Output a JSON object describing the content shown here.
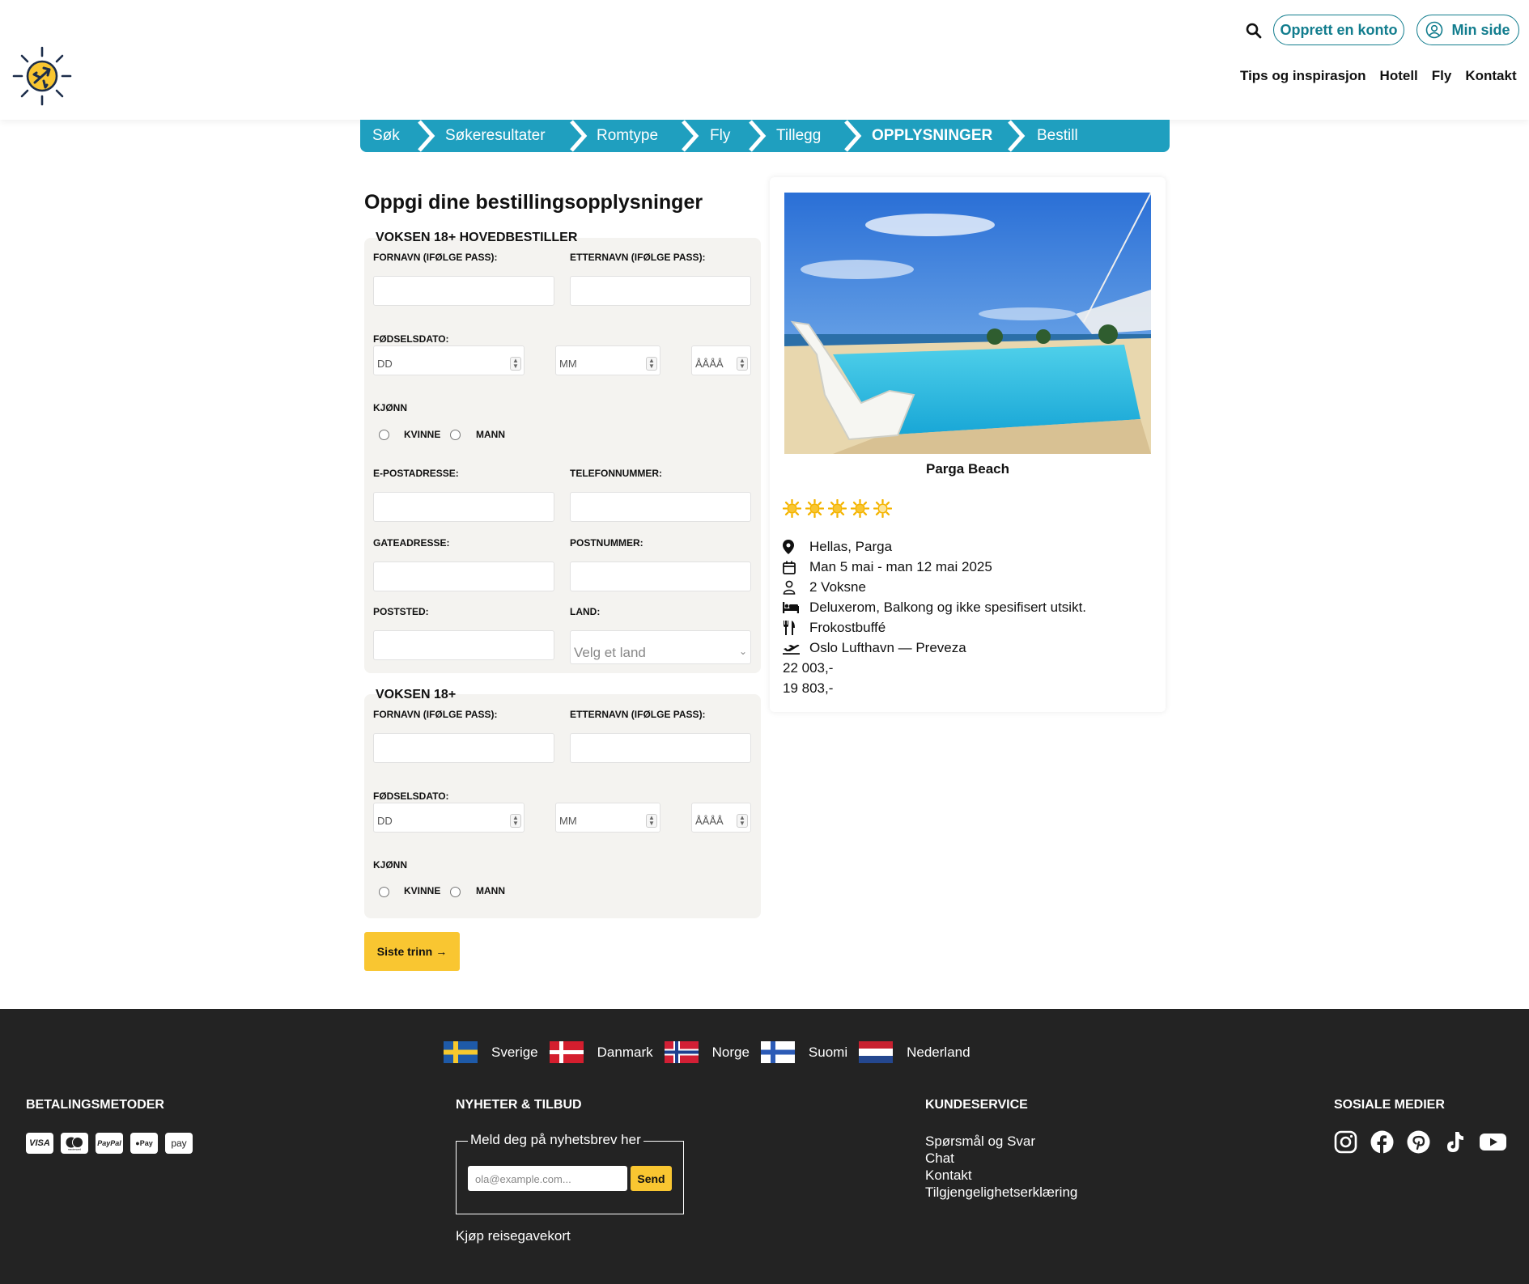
{
  "header": {
    "create_account": "Opprett en konto",
    "my_page": "Min side",
    "nav": [
      "Tips og inspirasjon",
      "Hotell",
      "Fly",
      "Kontakt"
    ]
  },
  "steps": [
    "Søk",
    "Søkeresultater",
    "Romtype",
    "Fly",
    "Tillegg",
    "OPPLYSNINGER",
    "Bestill"
  ],
  "form": {
    "title": "Oppgi dine bestillingsopplysninger",
    "section1": {
      "heading": "VOKSEN 18+ HOVEDBESTILLER",
      "first_name": "FORNAVN (IFØLGE PASS):",
      "last_name": "ETTERNAVN (IFØLGE PASS):",
      "birthdate": "FØDSELSDATO:",
      "day": "DD",
      "month": "MM",
      "year": "ÅÅÅÅ",
      "gender": "KJØNN",
      "female": "KVINNE",
      "male": "MANN",
      "email": "E-POSTADRESSE:",
      "phone": "TELEFONNUMMER:",
      "street": "GATEADRESSE:",
      "postcode": "POSTNUMMER:",
      "city": "POSTSTED:",
      "country": "LAND:",
      "country_placeholder": "Velg et land"
    },
    "section2": {
      "heading": "VOKSEN 18+",
      "first_name": "FORNAVN (IFØLGE PASS):",
      "last_name": "ETTERNAVN (IFØLGE PASS):",
      "birthdate": "FØDSELSDATO:",
      "day": "DD",
      "month": "MM",
      "year": "ÅÅÅÅ",
      "gender": "KJØNN",
      "female": "KVINNE",
      "male": "MANN"
    },
    "next_button": "Siste trinn"
  },
  "summary": {
    "hotel_name": "Parga Beach",
    "rating": 4.5,
    "location": "Hellas, Parga",
    "dates": "Man 5 mai - man 12 mai 2025",
    "guests": "2 Voksne",
    "room": "Deluxerom, Balkong og ikke spesifisert utsikt.",
    "board": "Frokostbuffé",
    "flight": "Oslo Lufthavn — Preveza",
    "price_original": "22 003,-",
    "price_current": "19 803,-"
  },
  "footer": {
    "countries": [
      "Sverige",
      "Danmark",
      "Norge",
      "Suomi",
      "Nederland"
    ],
    "payment_heading": "BETALINGSMETODER",
    "payment_methods": [
      "VISA",
      "mastercard",
      "PayPal",
      "Pay",
      "pay"
    ],
    "news_heading": "NYHETER & TILBUD",
    "newsletter_legend": "Meld deg på nyhetsbrev her",
    "newsletter_placeholder": "ola@example.com...",
    "newsletter_send": "Send",
    "giftcard": "Kjøp reisegavekort",
    "service_heading": "KUNDESERVICE",
    "service_links": [
      "Spørsmål og Svar",
      "Chat",
      "Kontakt",
      "Tilgjengelighetserklæring"
    ],
    "social_heading": "SOSIALE MEDIER",
    "social": [
      "instagram-icon",
      "facebook-icon",
      "pinterest-icon",
      "tiktok-icon",
      "youtube-icon"
    ],
    "colors": {
      "background": "#232323",
      "accent": "#f9c631"
    }
  },
  "colors": {
    "brand": "#1f9fbf",
    "button": "#f9c631",
    "link": "#127d8e"
  }
}
